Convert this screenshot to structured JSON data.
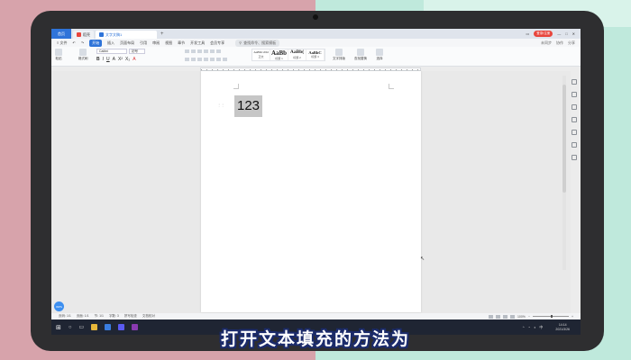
{
  "titlebar": {
    "home_label": "首页",
    "tabs": [
      {
        "label": "稻壳",
        "active": false,
        "color": "#e8453c"
      },
      {
        "label": "文字文稿1",
        "active": true,
        "color": "#2f74d9"
      }
    ],
    "new_tab": "+",
    "login_button": "登录/注册"
  },
  "menubar": {
    "file_label": "≡ 文件",
    "items": [
      "开始",
      "插入",
      "页面布局",
      "引用",
      "审阅",
      "视图",
      "章节",
      "开发工具",
      "会员专享"
    ],
    "active_item": "开始",
    "search_placeholder": "查找命令、搜索模板",
    "right_items": [
      "未同步",
      "协作",
      "分享"
    ]
  },
  "ribbon": {
    "clipboard": [
      "粘贴",
      "格式刷"
    ],
    "font_name": "Calibri",
    "font_size": "初号",
    "format_buttons": [
      "B",
      "I",
      "U",
      "A",
      "X²",
      "X₂",
      "A"
    ],
    "styles": [
      {
        "sample": "AaBbCcDd",
        "label": "正文"
      },
      {
        "sample": "AaBb",
        "label": "标题 1"
      },
      {
        "sample": "AaBb(",
        "label": "标题 2"
      },
      {
        "sample": "AaBbC",
        "label": "标题 3"
      }
    ],
    "tools": [
      "文字排版",
      "查找替换",
      "选择"
    ]
  },
  "document": {
    "selected_text": "123"
  },
  "statusbar": {
    "left_items": [
      "页码: 1/1",
      "页面: 1/1",
      "节: 1/1",
      "字数: 3",
      "拼写检查",
      "文档校对"
    ],
    "zoom": "100%",
    "badge": "WPS"
  },
  "taskbar": {
    "time": "14:14",
    "date": "2021/3/26"
  },
  "caption": "打开文本填充的方法为"
}
